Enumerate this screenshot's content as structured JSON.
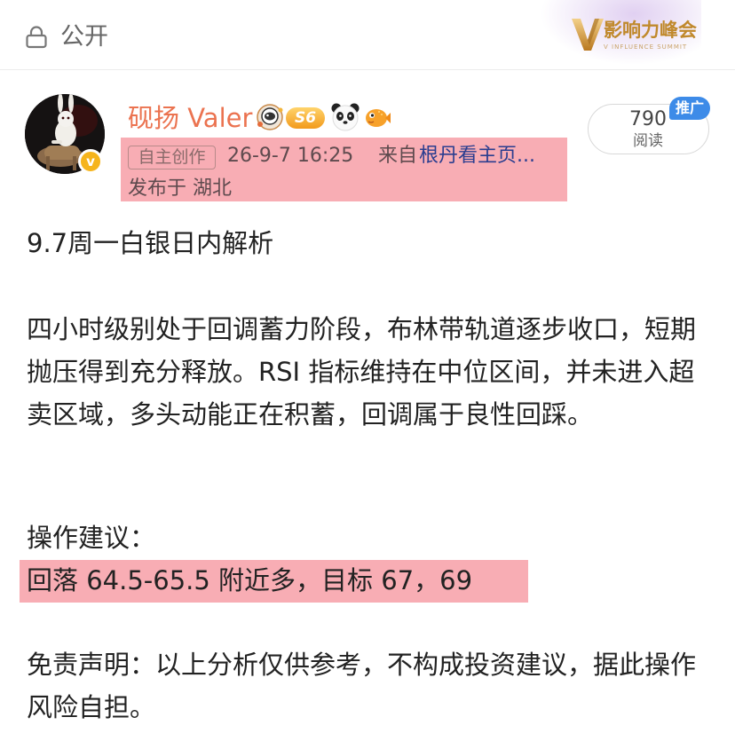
{
  "header": {
    "visibility_label": "公开",
    "summit_logo": {
      "title": "影响力峰会",
      "subtitle": "V INFLUENCE SUMMIT"
    }
  },
  "post": {
    "author": {
      "name": "砚扬 Valer",
      "level_badge": "S6",
      "badges": [
        "astronaut-badge-icon",
        "s6-level-badge",
        "panda-badge-icon",
        "pufferfish-badge-icon"
      ]
    },
    "meta": {
      "original_tag": "自主创作",
      "timestamp": "26-9-7 16:25",
      "source_prefix": "来自",
      "source_name": "根丹看主页...",
      "location": "发布于 湖北"
    },
    "stats": {
      "read_count": "790",
      "read_label": "阅读",
      "promo_label": "推广"
    },
    "content": {
      "title": "9.7周一白银日内解析",
      "body": "四小时级别处于回调蓄力阶段，布林带轨道逐步收口，短期抛压得到充分释放。RSI 指标维持在中位区间，并未进入超卖区域，多头动能正在积蓄，回调属于良性回踩。",
      "advice_heading": "操作建议：",
      "advice_detail": "回落 64.5-65.5 附近多，目标 67，69",
      "disclaimer": "免责声明：以上分析仅供参考，不构成投资建议，据此操作风险自担。"
    }
  },
  "colors": {
    "username": "#eb7350",
    "link": "#2a3d8f",
    "highlight": "#f37a86",
    "promo": "#3d8be8",
    "verified": "#f6b41b",
    "summit_gold": "#c0892c"
  }
}
